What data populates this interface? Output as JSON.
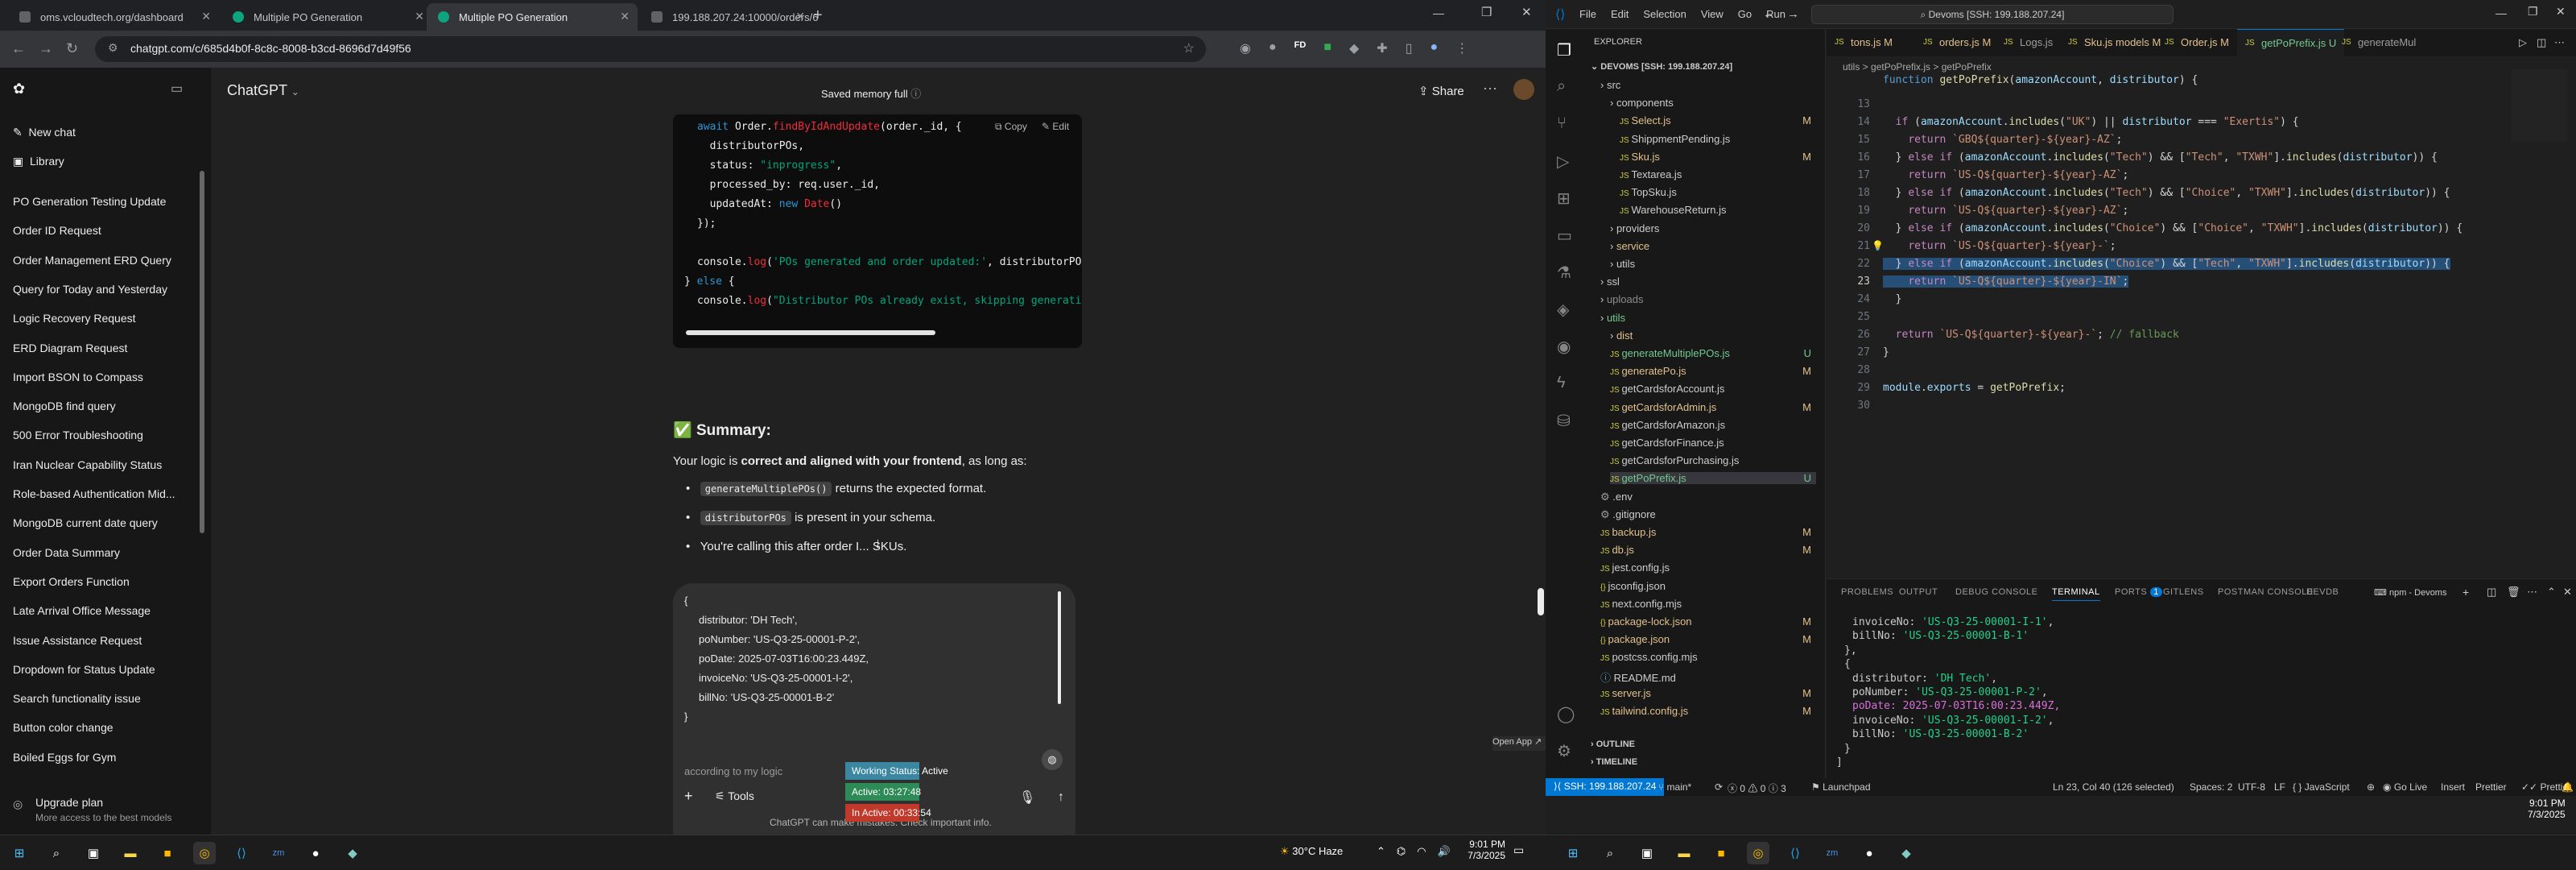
{
  "browser": {
    "tabs": [
      {
        "label": "oms.vcloudtech.org/dashboard",
        "fav": "#5f6368"
      },
      {
        "label": "Multiple PO Generation",
        "fav": "#10a37f"
      },
      {
        "label": "Multiple PO Generation",
        "fav": "#10a37f"
      },
      {
        "label": "199.188.207.24:10000/orders/6",
        "fav": "#5f6368"
      }
    ],
    "new_tab": "+",
    "url": "chatgpt.com/c/685d4b0f-8c8c-8008-b3cd-8696d7d49f56"
  },
  "chatgpt": {
    "sidebar": {
      "new_chat": "New chat",
      "library": "Library",
      "items": [
        "PO Generation Testing Update",
        "Order ID Request",
        "Order Management ERD Query",
        "Query for Today and Yesterday",
        "Logic Recovery Request",
        "ERD Diagram Request",
        "Import BSON to Compass",
        "MongoDB find query",
        "500 Error Troubleshooting",
        "Iran Nuclear Capability Status",
        "Role-based Authentication Mid...",
        "MongoDB current date query",
        "Order Data Summary",
        "Export Orders Function",
        "Late Arrival Office Message",
        "Issue Assistance Request",
        "Dropdown for Status Update",
        "Search functionality issue",
        "Button color change",
        "Boiled Eggs for Gym"
      ],
      "upgrade": "Upgrade plan",
      "upgrade_sub": "More access to the best models"
    },
    "header": {
      "model": "ChatGPT",
      "memory": "Saved memory full",
      "share": "Share"
    },
    "code": {
      "copy": "Copy",
      "edit": "Edit"
    },
    "summary": {
      "title": "Summary:",
      "intro_a": "Your logic is ",
      "intro_b": "correct and aligned with your frontend",
      "intro_c": ", as long as:",
      "bullets": [
        {
          "code": "generateMultiplePOs()",
          "text": " returns the expected format."
        },
        {
          "code": "distributorPOs",
          "text": " is present in your schema."
        },
        {
          "code": "",
          "text": "You're calling this after order I... SKUs."
        }
      ]
    },
    "input_preview": [
      "{",
      "distributor: 'DH Tech',",
      "poNumber: 'US-Q3-25-00001-P-2',",
      "poDate: 2025-07-03T16:00:23.449Z,",
      "invoiceNo: 'US-Q3-25-00001-I-2',",
      "billNo: 'US-Q3-25-00001-B-2'",
      "}"
    ],
    "partial_line": "according to my logic",
    "tools": "Tools",
    "disclaimer": "ChatGPT can make mistakes. Check important info.",
    "timer": {
      "open_app": "Open App",
      "working": "Working Status: Active",
      "active": "Active: 03:27:48",
      "inactive": "In Active: 00:33:54"
    }
  },
  "vscode": {
    "menu": [
      "File",
      "Edit",
      "Selection",
      "View",
      "Go",
      "Run"
    ],
    "search": "Devoms [SSH: 199.188.207.24]",
    "explorer_title": "EXPLORER",
    "root": "DEVOMS [SSH: 199.188.207.24]",
    "tree": [
      {
        "name": "src",
        "mark": "",
        "color": "#cccccc"
      },
      {
        "name": "components",
        "mark": "",
        "color": "#cccccc"
      },
      {
        "name": "Select.js",
        "mark": "M",
        "color": "#e2c08d"
      },
      {
        "name": "ShippmentPending.js",
        "mark": "",
        "color": "#cccccc"
      },
      {
        "name": "Sku.js",
        "mark": "M",
        "color": "#e2c08d"
      },
      {
        "name": "Textarea.js",
        "mark": "",
        "color": "#cccccc"
      },
      {
        "name": "TopSku.js",
        "mark": "",
        "color": "#cccccc"
      },
      {
        "name": "WarehouseReturn.js",
        "mark": "",
        "color": "#cccccc"
      },
      {
        "name": "providers",
        "mark": "",
        "color": "#cccccc"
      },
      {
        "name": "service",
        "mark": "",
        "color": "#e2c08d"
      },
      {
        "name": "utils",
        "mark": "",
        "color": "#cccccc"
      },
      {
        "name": "ssl",
        "mark": "",
        "color": "#cccccc"
      },
      {
        "name": "uploads",
        "mark": "",
        "color": "#8c8c8c"
      },
      {
        "name": "utils",
        "mark": "",
        "color": "#73c991"
      },
      {
        "name": "dist",
        "mark": "",
        "color": "#e2c08d"
      },
      {
        "name": "generateMultiplePOs.js",
        "mark": "U",
        "color": "#73c991"
      },
      {
        "name": "generatePo.js",
        "mark": "M",
        "color": "#e2c08d"
      },
      {
        "name": "getCardsforAccount.js",
        "mark": "",
        "color": "#cccccc"
      },
      {
        "name": "getCardsforAdmin.js",
        "mark": "M",
        "color": "#e2c08d"
      },
      {
        "name": "getCardsforAmazon.js",
        "mark": "",
        "color": "#cccccc"
      },
      {
        "name": "getCardsforFinance.js",
        "mark": "",
        "color": "#cccccc"
      },
      {
        "name": "getCardsforPurchasing.js",
        "mark": "",
        "color": "#cccccc"
      },
      {
        "name": "getPoPrefix.js",
        "mark": "U",
        "color": "#73c991"
      },
      {
        "name": ".env",
        "mark": "",
        "color": "#cccccc"
      },
      {
        "name": ".gitignore",
        "mark": "",
        "color": "#cccccc"
      },
      {
        "name": "backup.js",
        "mark": "M",
        "color": "#e2c08d"
      },
      {
        "name": "db.js",
        "mark": "M",
        "color": "#e2c08d"
      },
      {
        "name": "jest.config.js",
        "mark": "",
        "color": "#cccccc"
      },
      {
        "name": "jsconfig.json",
        "mark": "",
        "color": "#cccccc"
      },
      {
        "name": "next.config.mjs",
        "mark": "",
        "color": "#cccccc"
      },
      {
        "name": "package-lock.json",
        "mark": "M",
        "color": "#e2c08d"
      },
      {
        "name": "package.json",
        "mark": "M",
        "color": "#e2c08d"
      },
      {
        "name": "postcss.config.mjs",
        "mark": "",
        "color": "#cccccc"
      },
      {
        "name": "README.md",
        "mark": "",
        "color": "#cccccc"
      },
      {
        "name": "server.js",
        "mark": "M",
        "color": "#e2c08d"
      },
      {
        "name": "tailwind.config.js",
        "mark": "M",
        "color": "#e2c08d"
      }
    ],
    "outline": "OUTLINE",
    "timeline": "TIMELINE",
    "tabs": [
      "tons.js M",
      "orders.js M",
      "Logs.js",
      "Sku.js models M",
      "Order.js M",
      "getPoPrefix.js U",
      "generateMul"
    ],
    "breadcrumb": "utils > getPoPrefix.js > getPoPrefix",
    "panel_tabs": [
      "PROBLEMS",
      "OUTPUT",
      "DEBUG CONSOLE",
      "TERMINAL",
      "PORTS",
      "GITLENS",
      "POSTMAN CONSOLE",
      "DEVDB"
    ],
    "ports_count": "1",
    "terminal_name": "npm - Devoms",
    "terminal": [
      "invoiceNo: 'US-Q3-25-00001-I-1',",
      "billNo: 'US-Q3-25-00001-B-1'",
      "},",
      "{",
      "distributor: 'DH Tech',",
      "poNumber: 'US-Q3-25-00001-P-2',",
      "poDate: 2025-07-03T16:00:23.449Z,",
      "invoiceNo: 'US-Q3-25-00001-I-2',",
      "billNo: 'US-Q3-25-00001-B-2'",
      "}",
      "]"
    ],
    "status": {
      "ssh": "SSH: 199.188.207.24",
      "branch": "main*",
      "errors": "0",
      "warnings": "0",
      "info": "3",
      "launchpad": "Launchpad",
      "position": "Ln 23, Col 40 (126 selected)",
      "spaces": "Spaces: 2",
      "encoding": "UTF-8",
      "eol": "LF",
      "lang": "JavaScript",
      "golive": "Go Live",
      "insert": "Insert",
      "prettier": "Prettier",
      "prettier2": "Prettier"
    }
  },
  "taskbar": {
    "weather": "30°C Haze",
    "time_left": "9:01 PM",
    "date_left": "7/3/2025",
    "time_right": "9:01 PM",
    "date_right": "7/3/2025"
  }
}
